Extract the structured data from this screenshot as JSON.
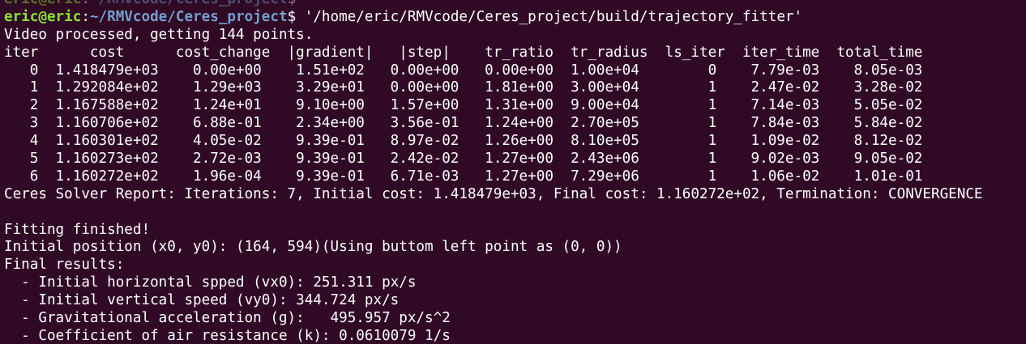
{
  "colors": {
    "background": "#300a24",
    "foreground": "#ffffff",
    "prompt_user": "#8ae234",
    "prompt_path": "#729fcf"
  },
  "prompt_prev": {
    "user": "eric@eric",
    "sep": ":",
    "path": "~/RMVcode/Ceres_project",
    "symbol": "$"
  },
  "prompt": {
    "user": "eric@eric",
    "sep": ":",
    "path": "~/RMVcode/Ceres_project",
    "symbol": "$",
    "command": " '/home/eric/RMVcode/Ceres_project/build/trajectory_fitter'"
  },
  "output": {
    "video": "Video processed, getting 144 points.",
    "header": "iter      cost      cost_change  |gradient|   |step|    tr_ratio  tr_radius  ls_iter  iter_time  total_time",
    "rows": [
      "   0  1.418479e+03    0.00e+00    1.51e+02   0.00e+00   0.00e+00  1.00e+04        0    7.79e-03    8.05e-03",
      "   1  1.292084e+02    1.29e+03    3.29e+01   0.00e+00   1.81e+00  3.00e+04        1    2.47e-02    3.28e-02",
      "   2  1.167588e+02    1.24e+01    9.10e+00   1.57e+00   1.31e+00  9.00e+04        1    7.14e-03    5.05e-02",
      "   3  1.160706e+02    6.88e-01    2.34e+00   3.56e-01   1.24e+00  2.70e+05        1    7.84e-03    5.84e-02",
      "   4  1.160301e+02    4.05e-02    9.39e-01   8.97e-02   1.26e+00  8.10e+05        1    1.09e-02    8.12e-02",
      "   5  1.160273e+02    2.72e-03    9.39e-01   2.42e-02   1.27e+00  2.43e+06        1    9.02e-03    9.05e-02",
      "   6  1.160272e+02    1.96e-04    9.39e-01   6.71e-03   1.27e+00  7.29e+06        1    1.06e-02    1.01e-01"
    ],
    "report": "Ceres Solver Report: Iterations: 7, Initial cost: 1.418479e+03, Final cost: 1.160272e+02, Termination: CONVERGENCE",
    "blank": "",
    "fitting": "Fitting finished!",
    "initial_position": "Initial position (x0, y0): (164, 594)(Using buttom left point as (0, 0))",
    "final_results": "Final results:",
    "vx": "  - Initial horizontal spped (vx0): 251.311 px/s",
    "vy": "  - Initial vertical speed (vy0): 344.724 px/s",
    "g": "  - Gravitational acceleration (g):   495.957 px/s^2",
    "k": "  - Coefficient of air resistance (k): 0.0610079 1/s"
  }
}
